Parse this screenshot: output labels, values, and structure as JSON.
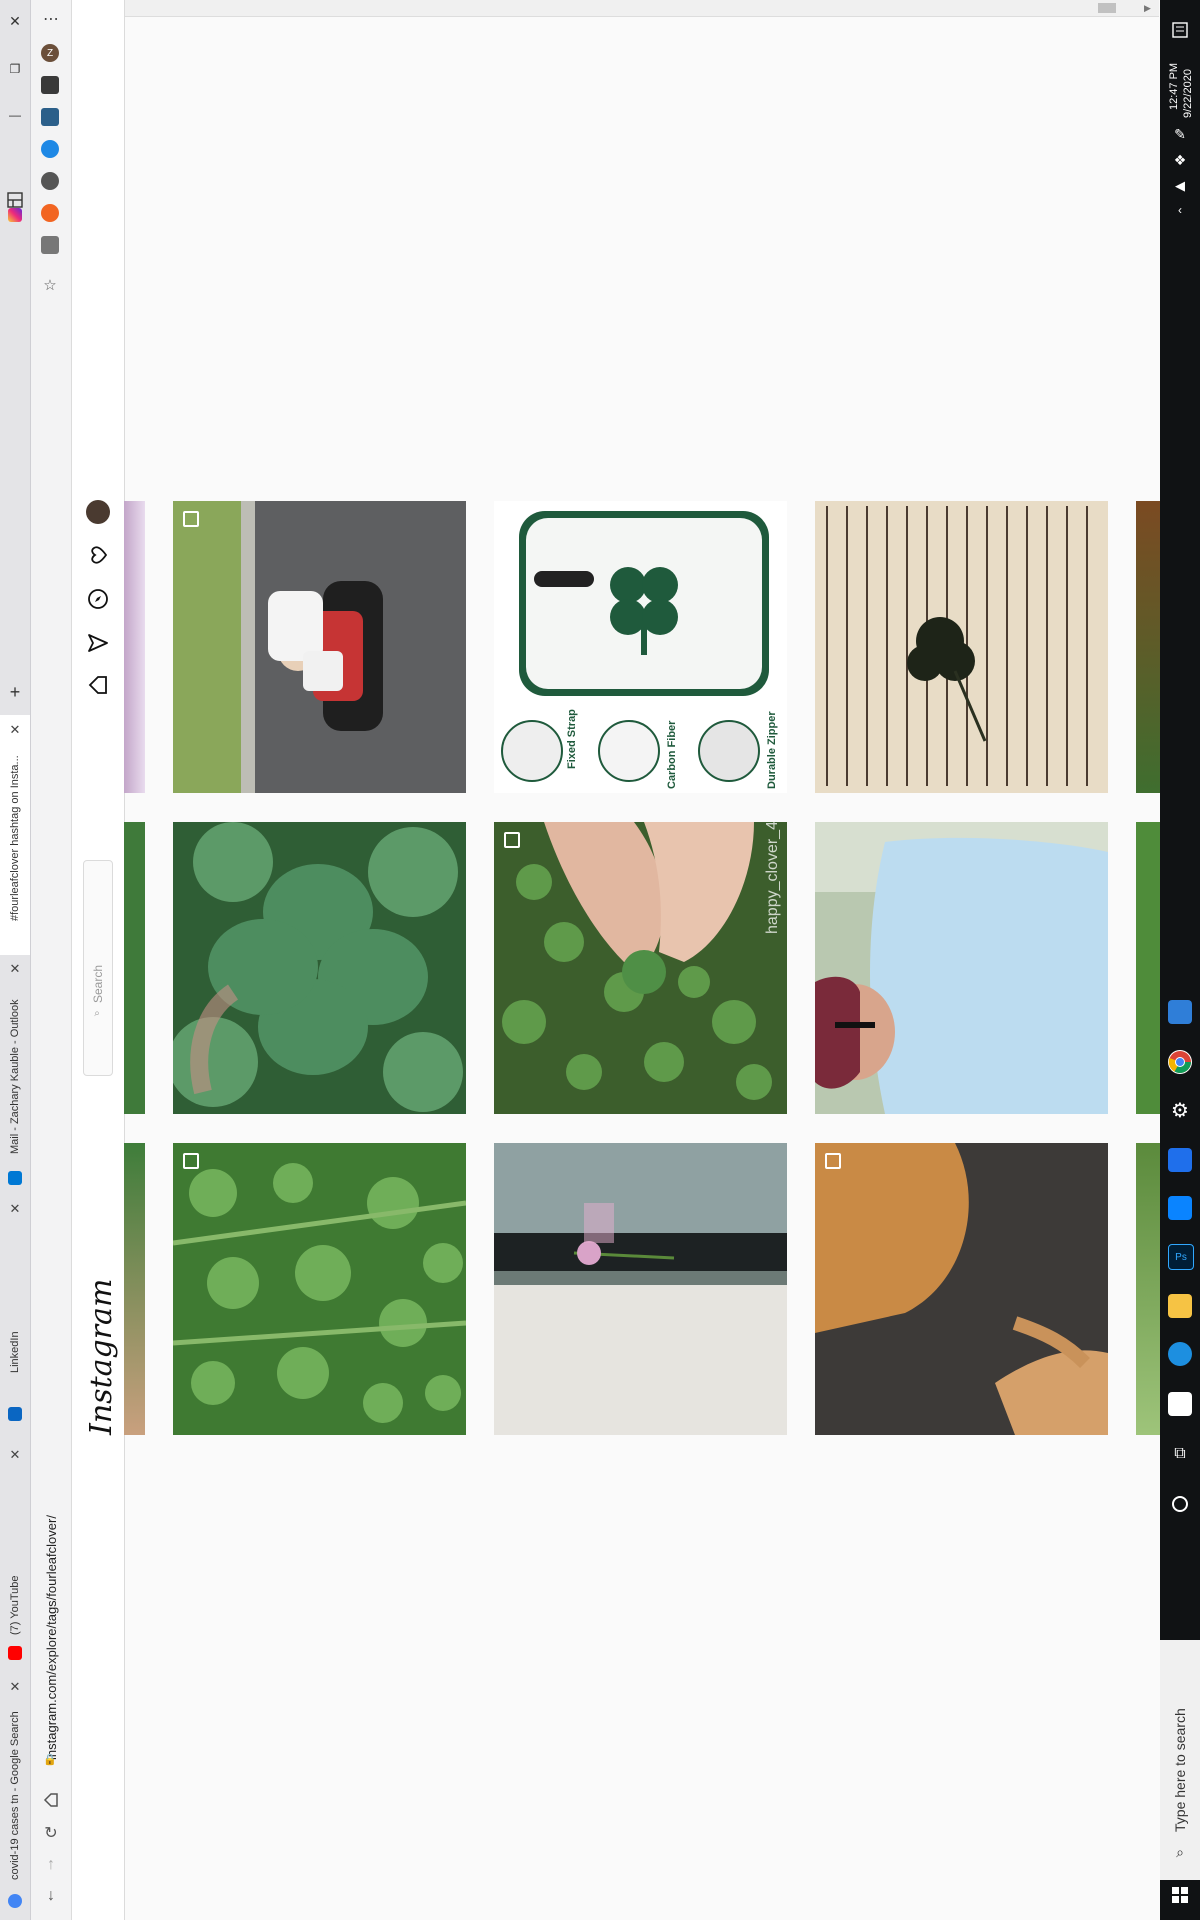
{
  "browser": {
    "tabs": [
      {
        "title": "covid-19 cases tn - Google Search",
        "favicon_color": "#4285f4"
      },
      {
        "title": "(7) YouTube",
        "favicon_color": "#ff0000"
      },
      {
        "title": "LinkedIn",
        "favicon_color": "#0a66c2"
      },
      {
        "title": "Mail - Zachary Kauble - Outlook",
        "favicon_color": "#0078d4"
      },
      {
        "title": "#fourleafclover hashtag on Insta...",
        "favicon_color": "#e1306c"
      }
    ],
    "new_tab_label": "+",
    "url": "instagram.com/explore/tags/fourleafclover/",
    "window_controls": {
      "close": "✕",
      "restore": "❐",
      "minimize": "—"
    },
    "menu_glyph": "⋯",
    "profile_initial": "Z",
    "extension_colors": [
      "#6b4f3a",
      "#3a3a3a",
      "#2b5f8a",
      "#1e88e5",
      "#555555",
      "#f26522",
      "#777777"
    ]
  },
  "instagram": {
    "logo": "Instagram",
    "search_placeholder": "Search",
    "nav_icons": [
      "home-icon",
      "direct-icon",
      "explore-icon",
      "activity-heart-icon",
      "profile-avatar"
    ],
    "tiles": [
      {
        "row": 1,
        "col": 1,
        "desc": "child on go-kart",
        "badge": "camera-icon",
        "overlay": ""
      },
      {
        "row": 1,
        "col": 2,
        "desc": "clover case product",
        "badge": "",
        "overlay": ""
      },
      {
        "row": 1,
        "col": 3,
        "desc": "clover pressed in book",
        "badge": "",
        "overlay": ""
      },
      {
        "row": 2,
        "col": 1,
        "desc": "four leaf clover close-up",
        "badge": "",
        "overlay": ""
      },
      {
        "row": 2,
        "col": 2,
        "desc": "hand holding clover",
        "badge": "gallery-icon",
        "overlay": "happy_clover_4"
      },
      {
        "row": 2,
        "col": 3,
        "desc": "person in blue shirt",
        "badge": "",
        "overlay": ""
      },
      {
        "row": 3,
        "col": 1,
        "desc": "clover patch",
        "badge": "gallery-icon",
        "overlay": ""
      },
      {
        "row": 3,
        "col": 2,
        "desc": "clover flower on windowsill",
        "badge": "",
        "overlay": ""
      },
      {
        "row": 3,
        "col": 3,
        "desc": "orange cat",
        "badge": "camera-icon",
        "overlay": ""
      }
    ],
    "product_labels": [
      "Fixed Strap",
      "Carbon Fiber",
      "Durable Zipper"
    ]
  },
  "taskbar": {
    "time": "12:47 PM",
    "date": "9/22/2020",
    "search_placeholder": "Type here to search",
    "app_colors": [
      "#ffffff",
      "#f6c344",
      "#0078d4",
      "#31a8ff",
      "#2f7ed8",
      "#0a84ff",
      "#ffffff",
      "#1f6feb"
    ]
  }
}
